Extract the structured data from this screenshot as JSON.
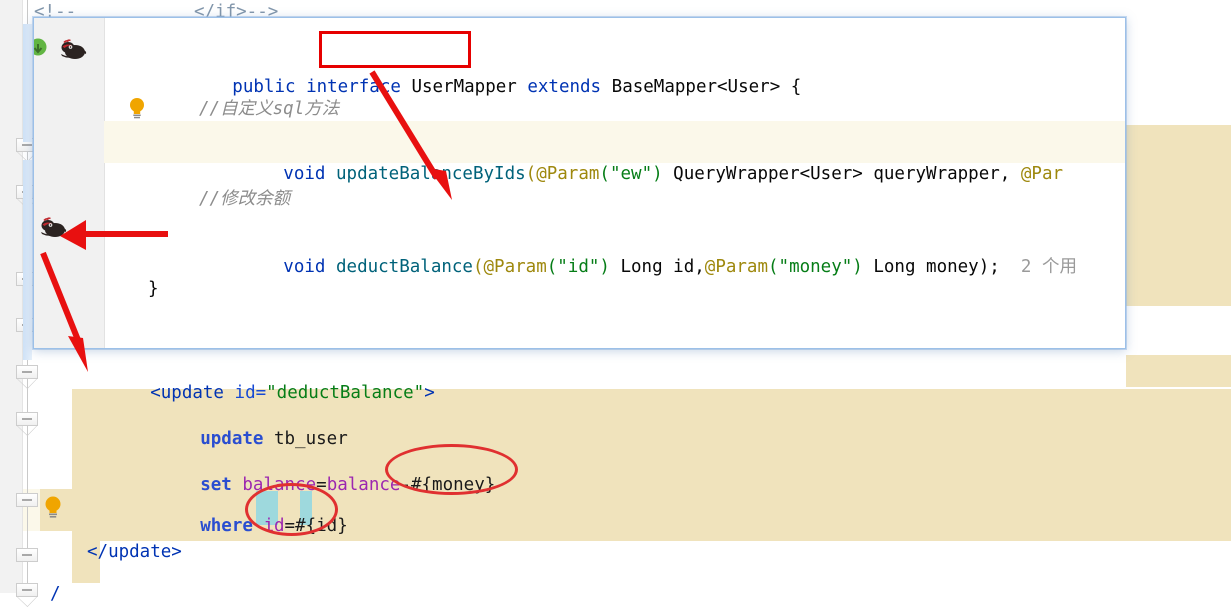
{
  "background_xml": {
    "top_comment_left": "<!--",
    "top_comment_right": "</if>-->",
    "update_open_tag": "<update",
    "update_attr_name": "id=",
    "update_attr_value": "\"deductBalance\"",
    "update_open_close": ">",
    "sql_line_1": "update tb_user",
    "sql_line_1_kw": "update",
    "sql_line_1_tbl": "tb_user",
    "sql_line_2_kw": "set",
    "sql_line_2_col_a": "balance",
    "sql_line_2_eq": "=",
    "sql_line_2_col_b": "balance",
    "sql_line_2_expr": "-#{money}",
    "sql_line_3_kw": "where",
    "sql_line_3_col": "id",
    "sql_line_3_eq": "=",
    "sql_line_3_param": "#{id}",
    "update_close_tag": "</update>",
    "bottom_partial": "/"
  },
  "java_popup": {
    "line1": {
      "modifier": "public",
      "keyword": "interface",
      "type_name": "UserMapper",
      "extends_kw": "extends",
      "super_type": "BaseMapper<User> {"
    },
    "line2_comment": "//自定义sql方法",
    "line3": {
      "return_type": "void",
      "method": "updateBalanceByIds",
      "open_paren": "(",
      "ann1": "@Param",
      "ann1_arg": "(\"ew\")",
      "param1_type": " QueryWrapper<User> ",
      "param1_name": "queryWrapper",
      "comma": ", ",
      "ann2": "@Par"
    },
    "line4_comment": "//修改余额",
    "line5": {
      "return_type": "void",
      "method": "deductBalance",
      "open_paren": "(",
      "ann1": "@Param",
      "ann1_arg": "(\"id\")",
      "param1": " Long id,",
      "ann2": "@Param",
      "ann2_arg": "(\"money\")",
      "param2": " Long money);",
      "usage_hint": "2 个用"
    },
    "line6_close_brace": "}"
  },
  "gutter_icons": {
    "implemented_icon": "implemented-method-icon",
    "mybatis_icon_1": "mybatis-navigate-icon",
    "mybatis_icon_2": "mybatis-navigate-icon",
    "intention_bulb": "intention-bulb-icon",
    "comment_bulb": "intention-bulb-icon"
  },
  "annotations": {
    "highlight_box_target": "UserMapper",
    "ellipse_1_target": "-#{money}",
    "ellipse_2_target": "#{id}",
    "arrow_1": "UserMapper-to-deductBalance-arrow",
    "arrow_2": "deductBalance-to-gutter-arrow",
    "arrow_3": "gutter-to-update-tag-arrow",
    "annotation_color": "#e60000"
  },
  "colors": {
    "keyword": "#0033b3",
    "string": "#067d17",
    "annotation_gold": "#9e880d",
    "comment_gray": "#8c8c8c",
    "sql_column_purple": "#9c27b0",
    "selection_beige": "#f0e3bc",
    "caret_row": "#fbf8ea",
    "bracket_cyan": "#9ed9dd",
    "popup_border": "#9cc0e8"
  }
}
